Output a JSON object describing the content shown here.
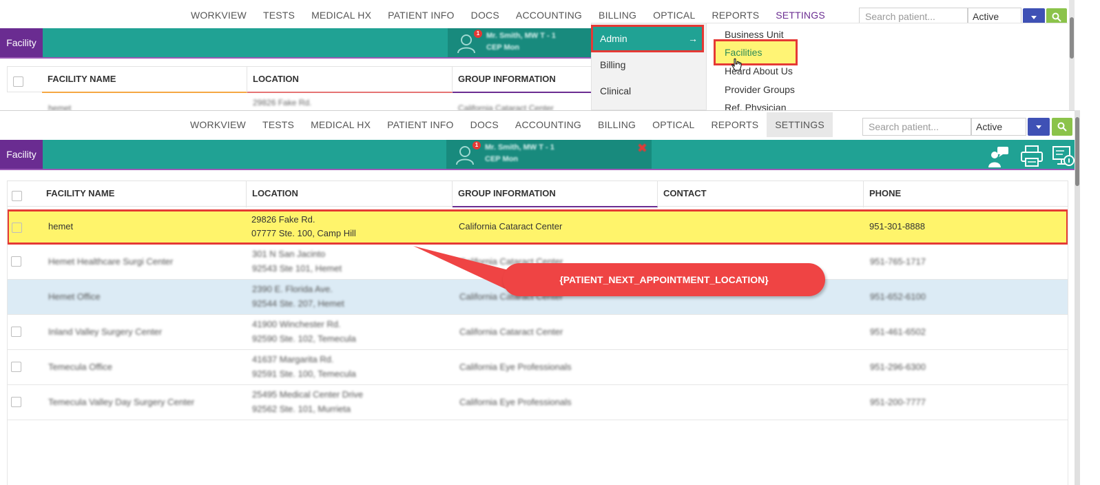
{
  "top_shot": {
    "nav_items": [
      "WORKVIEW",
      "TESTS",
      "MEDICAL HX",
      "PATIENT INFO",
      "DOCS",
      "ACCOUNTING",
      "BILLING",
      "OPTICAL",
      "REPORTS",
      "SETTINGS"
    ],
    "active_nav": "SETTINGS",
    "search_placeholder": "Search patient...",
    "status_value": "Active",
    "facility_tab": "Facility",
    "patient_badge": "1",
    "patient_name": "Mr. Smith, MW T - 1",
    "patient_id": "CEP Mon",
    "table_headers": [
      "FACILITY NAME",
      "LOCATION",
      "GROUP INFORMATION"
    ],
    "partial_row": {
      "name": "hemet",
      "location": "29826 Fake Rd.",
      "group": "California Cataract Center"
    },
    "menu": {
      "left_items": [
        "Admin",
        "Billing",
        "Clinical"
      ],
      "arrow": "→",
      "sub_items": [
        "Business Unit",
        "Facilities",
        "Heard About Us",
        "Provider Groups",
        "Ref. Physician"
      ]
    }
  },
  "bottom_shot": {
    "nav_items": [
      "WORKVIEW",
      "TESTS",
      "MEDICAL HX",
      "PATIENT INFO",
      "DOCS",
      "ACCOUNTING",
      "BILLING",
      "OPTICAL",
      "REPORTS",
      "SETTINGS"
    ],
    "search_placeholder": "Search patient...",
    "status_value": "Active",
    "facility_tab": "Facility",
    "patient_badge": "1",
    "patient_name": "Mr. Smith, MW T - 1",
    "patient_id": "CEP Mon",
    "close_symbol": "✖",
    "table_headers": [
      "FACILITY NAME",
      "LOCATION",
      "GROUP INFORMATION",
      "CONTACT",
      "PHONE"
    ],
    "rows": [
      {
        "name": "hemet",
        "loc1": "29826 Fake Rd.",
        "loc2": "07777 Ste. 100, Camp Hill",
        "group": "California Cataract Center",
        "contact": "",
        "phone": "951-301-8888"
      },
      {
        "name": "Hemet Healthcare Surgi Center",
        "loc1": "301 N San Jacinto",
        "loc2": "92543 Ste 101, Hemet",
        "group": "California Cataract Center",
        "contact": "",
        "phone": "951-765-1717"
      },
      {
        "name": "Hemet Office",
        "loc1": "2390 E. Florida Ave.",
        "loc2": "92544 Ste. 207, Hemet",
        "group": "California Cataract Center",
        "contact": "",
        "phone": "951-652-6100"
      },
      {
        "name": "Inland Valley Surgery Center",
        "loc1": "41900 Winchester Rd.",
        "loc2": "92590 Ste. 102, Temecula",
        "group": "California Cataract Center",
        "contact": "",
        "phone": "951-461-6502"
      },
      {
        "name": "Temecula Office",
        "loc1": "41637 Margarita Rd.",
        "loc2": "92591 Ste. 100, Temecula",
        "group": "California Eye Professionals",
        "contact": "",
        "phone": "951-296-6300"
      },
      {
        "name": "Temecula Valley Day Surgery Center",
        "loc1": "25495 Medical Center Drive",
        "loc2": "92562 Ste. 101, Murrieta",
        "group": "California Eye Professionals",
        "contact": "",
        "phone": "951-200-7777"
      }
    ],
    "callout_text": "{PATIENT_NEXT_APPOINTMENT_LOCATION}"
  },
  "colors": {
    "teal": "#20a294",
    "purple": "#6a2c91",
    "highlight_yellow": "#fff46b",
    "annotation_red": "#e53935",
    "selected_row_blue": "#dcebf5"
  }
}
